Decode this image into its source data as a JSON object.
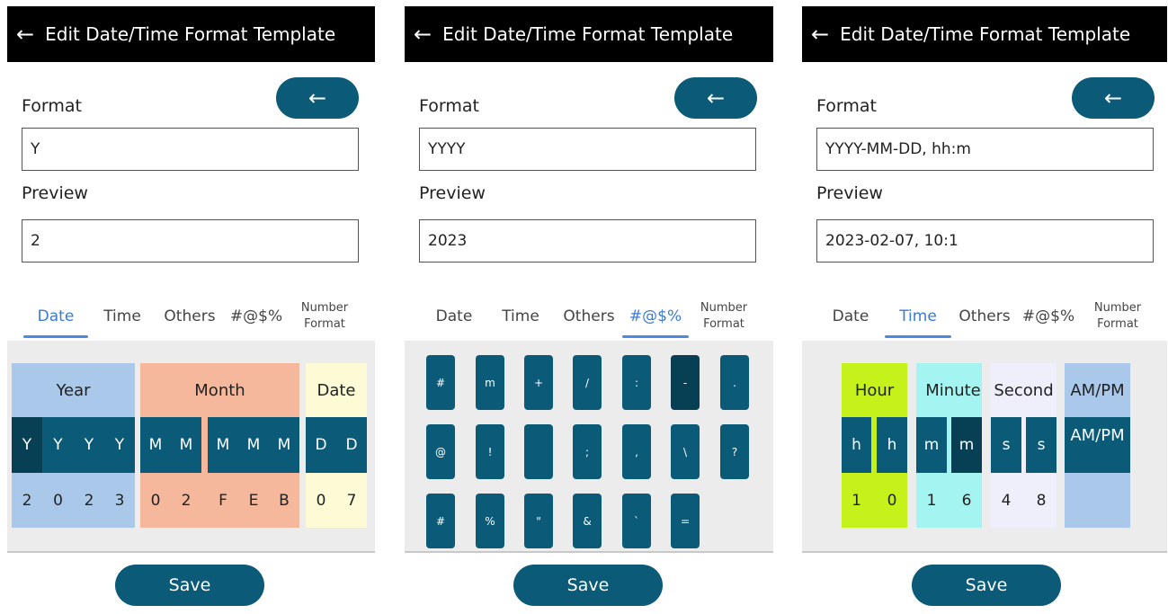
{
  "common": {
    "title": "Edit Date/Time Format Template",
    "back_arrow": "←",
    "format_label": "Format",
    "preview_label": "Preview",
    "save_label": "Save",
    "tabs": {
      "date": "Date",
      "time": "Time",
      "others": "Others",
      "symbols": "#@$%",
      "number_line1": "Number",
      "number_line2": "Format"
    },
    "colors": {
      "primary": "#0a5a78",
      "primary_selected": "#073f55",
      "tab_active": "#3a7bd5",
      "year_bg": "#a9c8ea",
      "month_bg": "#f5b89c",
      "date_bg": "#fdfad6",
      "hour_bg": "#c6f21c",
      "minute_bg": "#a4f5f2",
      "second_bg": "#efeefb",
      "ampm_bg": "#a9c8ea"
    }
  },
  "screen1": {
    "active_tab": "Date",
    "format_value": "Y",
    "preview_value": "2",
    "date_panel": {
      "year": {
        "header": "Year",
        "tokens": [
          "Y",
          "Y",
          "Y",
          "Y"
        ],
        "values": [
          "2",
          "0",
          "2",
          "3"
        ]
      },
      "month": {
        "header": "Month",
        "numeric_tokens": [
          "M",
          "M"
        ],
        "name_tokens": [
          "M",
          "M",
          "M"
        ],
        "numeric_values": [
          "0",
          "2"
        ],
        "name_values": [
          "F",
          "E",
          "B"
        ]
      },
      "date": {
        "header": "Date",
        "tokens": [
          "D",
          "D"
        ],
        "values": [
          "0",
          "7"
        ]
      }
    }
  },
  "screen2": {
    "active_tab": "#@$%",
    "format_value": "YYYY",
    "preview_value": "2023",
    "symbol_keys": [
      [
        "#",
        "m",
        "+",
        "/",
        ":",
        "-",
        "."
      ],
      [
        "@",
        "!",
        "",
        ";",
        ",",
        "\\",
        "?"
      ],
      [
        "#",
        "%",
        "\"",
        "&",
        "`",
        "="
      ]
    ],
    "selected_key": "-"
  },
  "screen3": {
    "active_tab": "Time",
    "format_value": "YYYY-MM-DD, hh:m",
    "preview_value": "2023-02-07, 10:1",
    "time_panel": {
      "hour": {
        "header": "Hour",
        "tokens": [
          "h",
          "h"
        ],
        "values": [
          "1",
          "0"
        ]
      },
      "minute": {
        "header": "Minute",
        "tokens": [
          "m",
          "m"
        ],
        "values": [
          "1",
          "6"
        ]
      },
      "second": {
        "header": "Second",
        "tokens": [
          "s",
          "s"
        ],
        "values": [
          "4",
          "8"
        ]
      },
      "ampm": {
        "header": "AM/PM",
        "token": "AM/PM"
      }
    }
  }
}
